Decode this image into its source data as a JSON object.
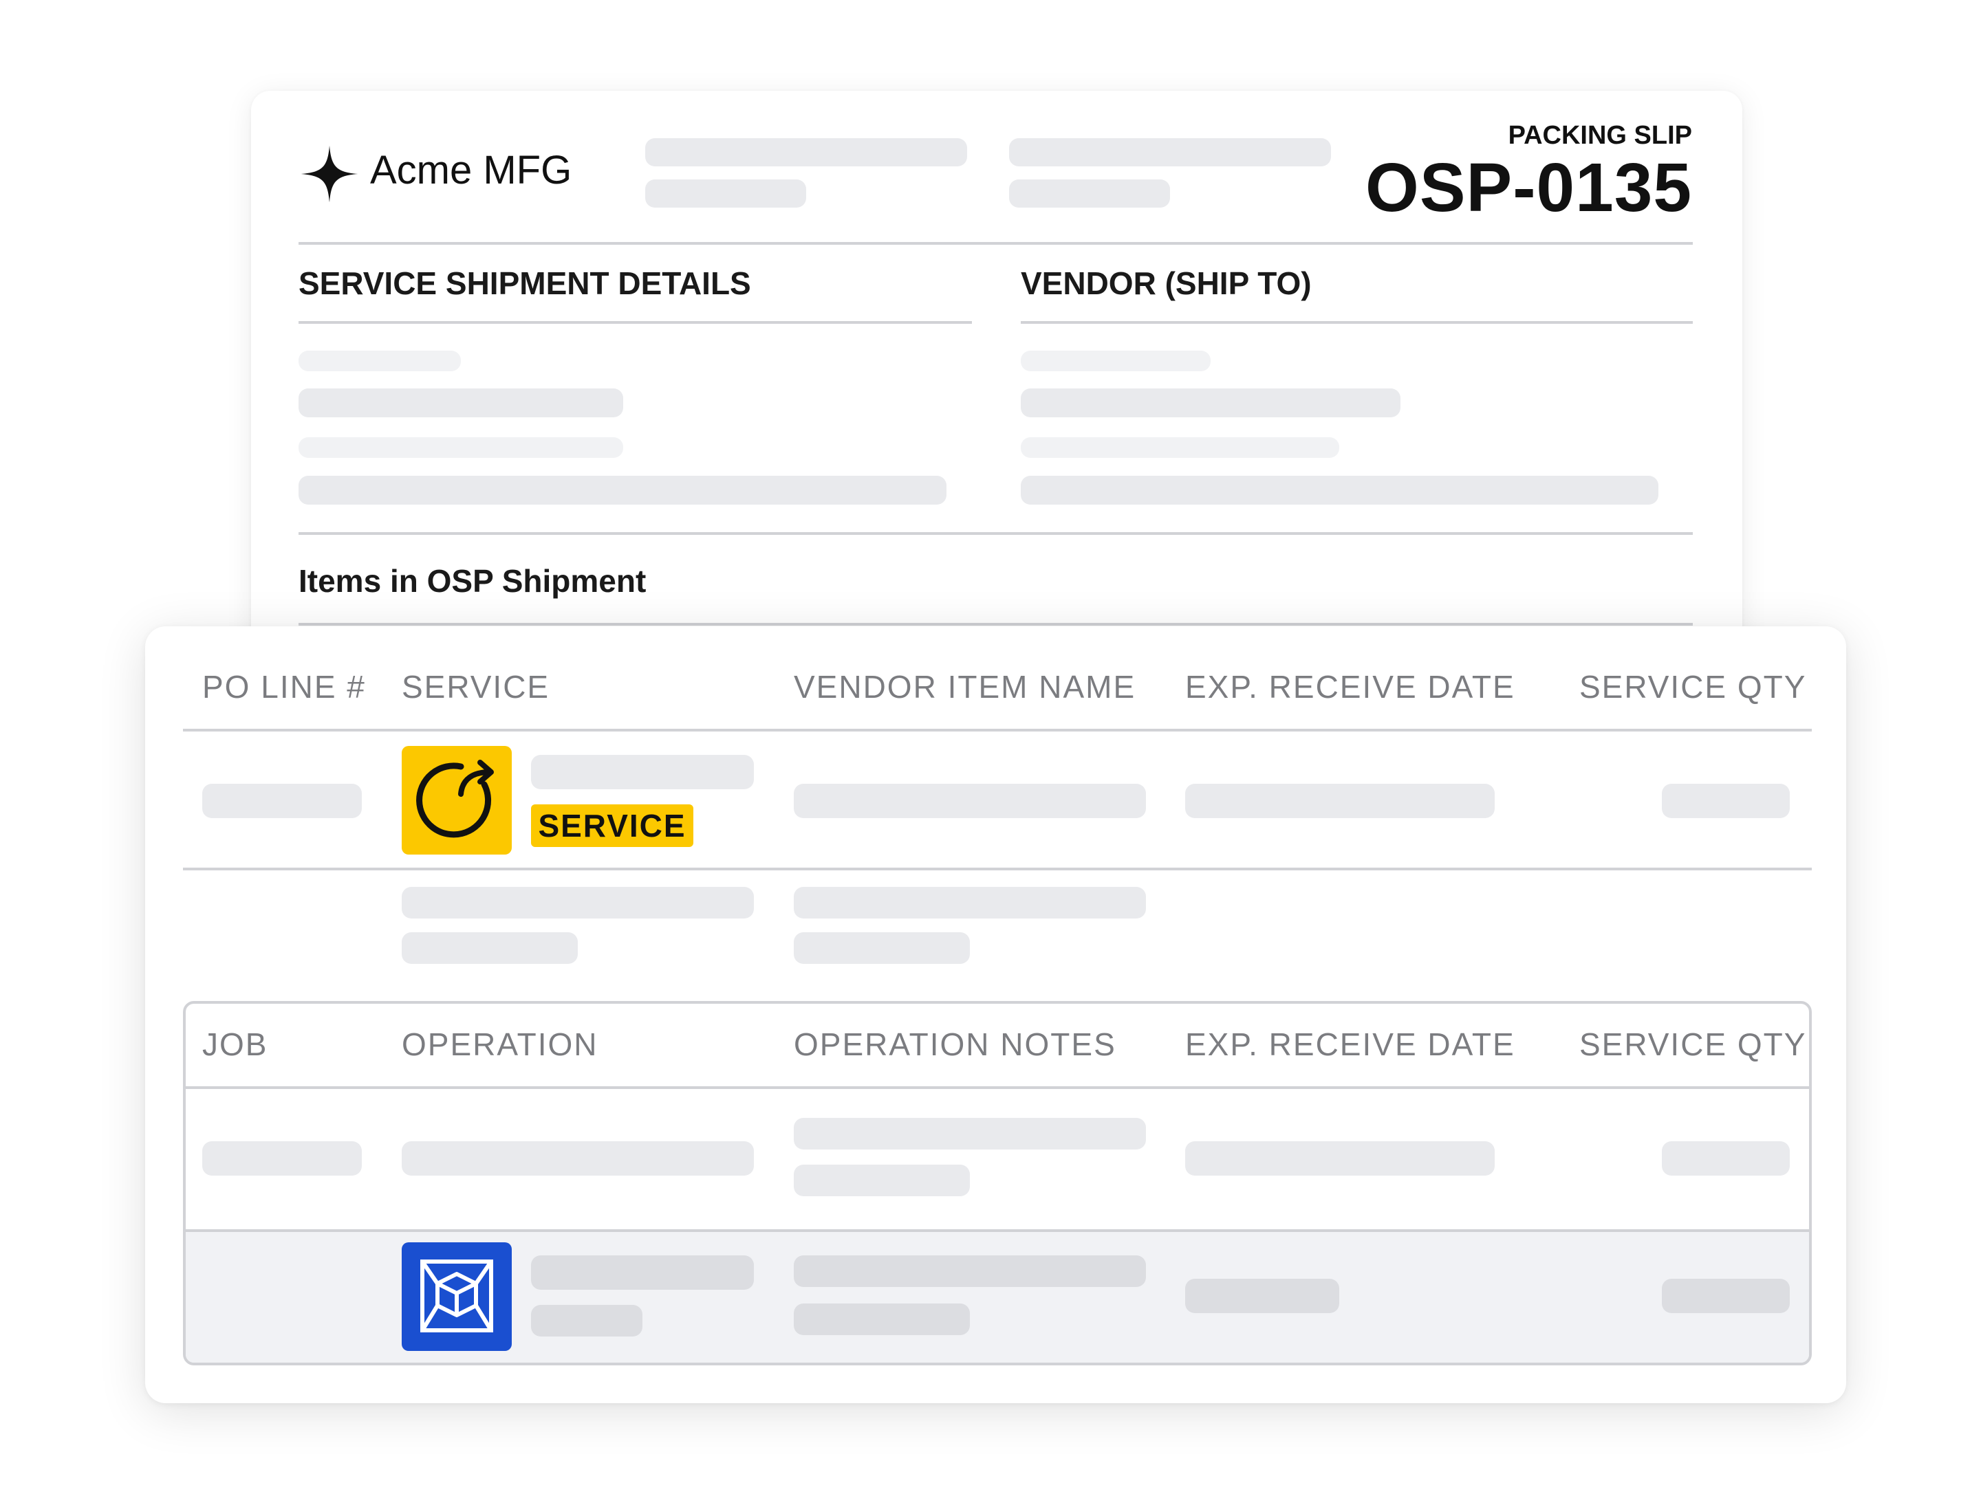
{
  "brand": {
    "name": "Acme MFG",
    "logo_icon": "four-point-star-icon"
  },
  "slip": {
    "label": "PACKING SLIP",
    "number": "OSP-0135"
  },
  "sections": {
    "shipment_details": "SERVICE SHIPMENT DETAILS",
    "vendor": "VENDOR (SHIP TO)",
    "items_title": "Items in OSP Shipment"
  },
  "items_table": {
    "columns": [
      "PO LINE #",
      "SERVICE",
      "VENDOR ITEM NAME",
      "EXP. RECEIVE DATE",
      "SERVICE QTY"
    ],
    "row_badge": "SERVICE",
    "row_icon": "service-refresh-icon"
  },
  "operations_table": {
    "columns": [
      "JOB",
      "OPERATION",
      "OPERATION NOTES",
      "EXP. RECEIVE DATE",
      "SERVICE QTY"
    ],
    "row_icon": "part-cube-icon"
  },
  "colors": {
    "service_yellow": "#fcc800",
    "part_blue": "#1a4fd0",
    "placeholder_gray": "#e9eaed",
    "header_text_gray": "#7b7c80"
  }
}
